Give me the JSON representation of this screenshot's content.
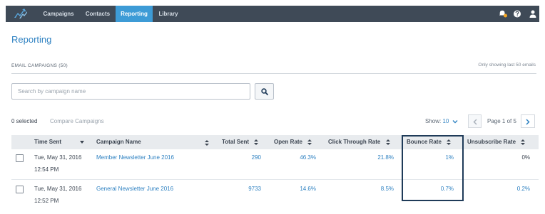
{
  "nav": {
    "items": [
      {
        "label": "Campaigns",
        "active": false
      },
      {
        "label": "Contacts",
        "active": false
      },
      {
        "label": "Reporting",
        "active": true
      },
      {
        "label": "Library",
        "active": false
      }
    ],
    "icons": [
      "logo-icon",
      "notifications-icon",
      "help-icon",
      "user-icon"
    ]
  },
  "page": {
    "title": "Reporting"
  },
  "section": {
    "label": "EMAIL CAMPAIGNS (50)",
    "note": "Only showing last 50 emails"
  },
  "search": {
    "placeholder": "Search by campaign name",
    "value": ""
  },
  "toolbar": {
    "selected": "0 selected",
    "compare": "Compare Campaigns",
    "show_label": "Show:",
    "show_value": "10",
    "page_label": "Page 1 of 5"
  },
  "table": {
    "columns": [
      "Time Sent",
      "Campaign Name",
      "Total Sent",
      "Open Rate",
      "Click Through Rate",
      "Bounce Rate",
      "Unsubscribe Rate"
    ],
    "rows": [
      {
        "date": "Tue, May 31, 2016",
        "time": "12:54 PM",
        "name": "Member Newsletter June 2016",
        "total_sent": "290",
        "open_rate": "46.3%",
        "ctr": "21.8%",
        "bounce": "1%",
        "unsub": "0%"
      },
      {
        "date": "Tue, May 31, 2016",
        "time": "12:52 PM",
        "name": "General Newsletter June 2016",
        "total_sent": "9733",
        "open_rate": "14.6%",
        "ctr": "8.5%",
        "bounce": "0.7%",
        "unsub": "0.2%"
      }
    ]
  },
  "colors": {
    "nav_bg": "#3f4a57",
    "nav_active": "#3d9bd6",
    "link": "#2f82c2",
    "header_bg": "#e8ebee",
    "highlight_border": "#1f3b59",
    "notification_dot": "#f5a623"
  }
}
